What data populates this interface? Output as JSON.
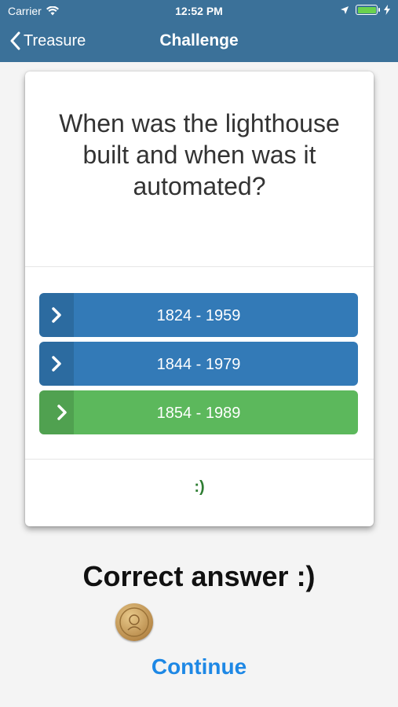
{
  "status_bar": {
    "carrier": "Carrier",
    "time": "12:52 PM"
  },
  "nav": {
    "back_label": "Treasure",
    "title": "Challenge"
  },
  "colors": {
    "header": "#3b7199",
    "answer_default": "#337ab7",
    "answer_correct": "#5cb85c",
    "feedback": "#2e7d32",
    "continue": "#1e88e5"
  },
  "question": "When was the lighthouse built and when was it automated?",
  "answers": [
    {
      "label": "1824 - 1959",
      "state": "default"
    },
    {
      "label": "1844 - 1979",
      "state": "default"
    },
    {
      "label": "1854 - 1989",
      "state": "correct"
    }
  ],
  "feedback": ":)",
  "result_text": "Correct answer :)",
  "coin_icon": "coin-icon",
  "continue_label": "Continue"
}
